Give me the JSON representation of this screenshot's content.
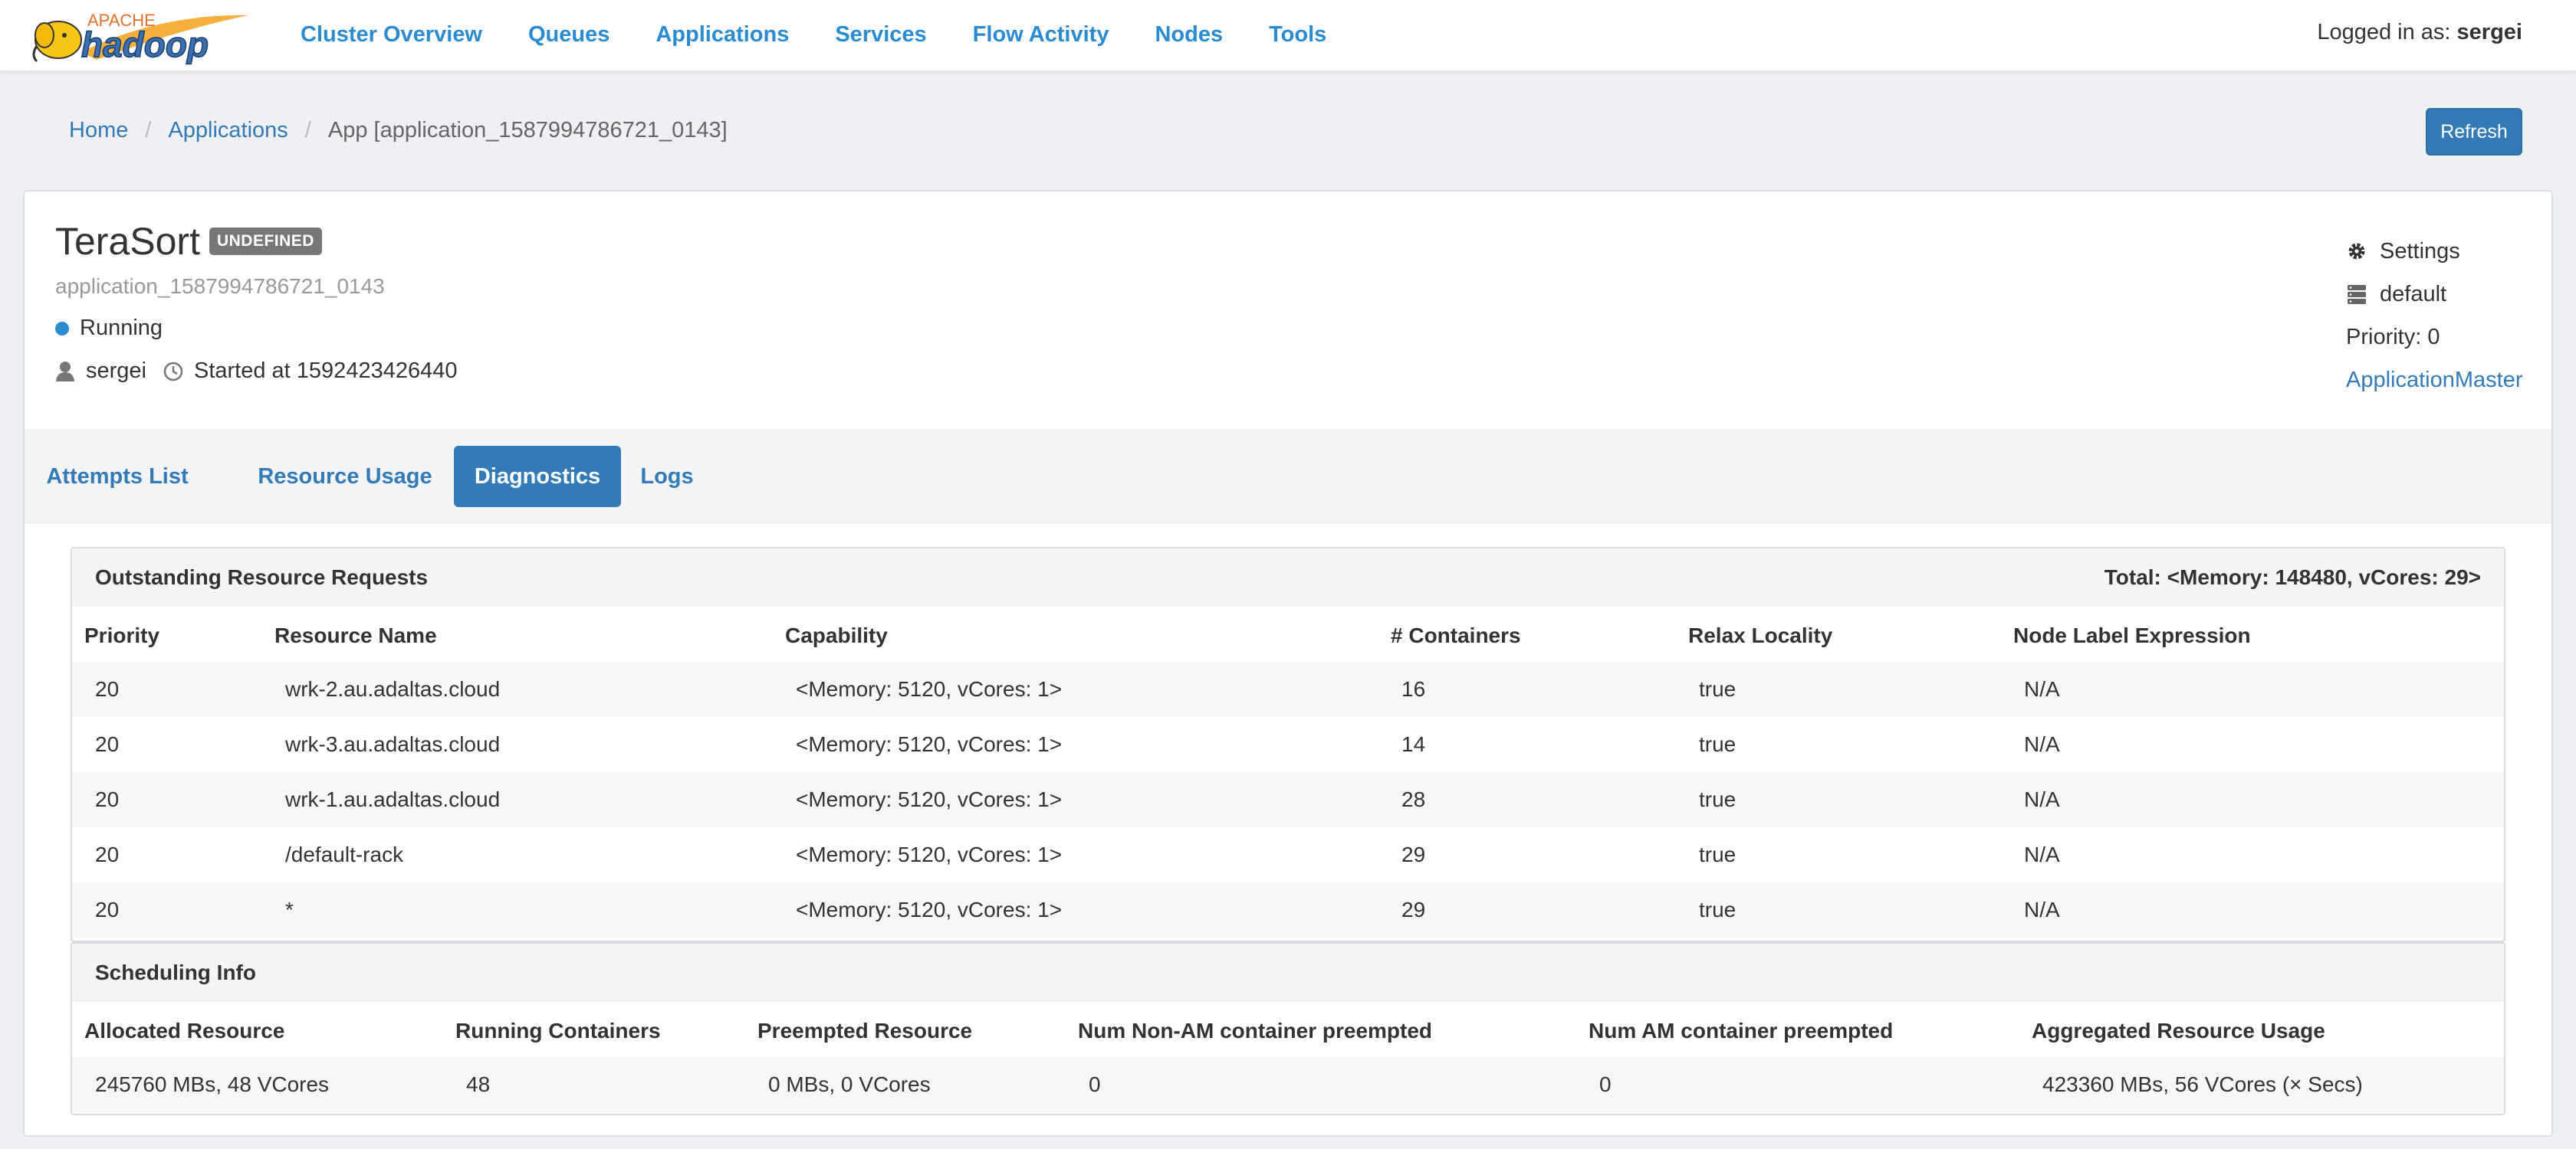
{
  "nav": {
    "logo_top": "APACHE",
    "logo_main": "hadoop",
    "links": [
      "Cluster Overview",
      "Queues",
      "Applications",
      "Services",
      "Flow Activity",
      "Nodes",
      "Tools"
    ],
    "login_prefix": "Logged in as:",
    "login_user": "sergei"
  },
  "breadcrumb": {
    "items": [
      "Home",
      "Applications"
    ],
    "current": "App [application_1587994786721_0143]"
  },
  "refresh_label": "Refresh",
  "app": {
    "name": "TeraSort",
    "badge": "UNDEFINED",
    "id": "application_1587994786721_0143",
    "state": "Running",
    "user": "sergei",
    "started": "Started at 1592423426440"
  },
  "side": {
    "settings": "Settings",
    "queue": "default",
    "priority": "Priority: 0",
    "am_link": "ApplicationMaster"
  },
  "tabs": [
    "Attempts List",
    "Resource Usage",
    "Diagnostics",
    "Logs"
  ],
  "active_tab": "Diagnostics",
  "requests": {
    "title": "Outstanding Resource Requests",
    "total": "Total: <Memory: 148480, vCores: 29>",
    "columns": [
      "Priority",
      "Resource Name",
      "Capability",
      "# Containers",
      "Relax Locality",
      "Node Label Expression"
    ],
    "rows": [
      [
        "20",
        "wrk-2.au.adaltas.cloud",
        "<Memory: 5120, vCores: 1>",
        "16",
        "true",
        "N/A"
      ],
      [
        "20",
        "wrk-3.au.adaltas.cloud",
        "<Memory: 5120, vCores: 1>",
        "14",
        "true",
        "N/A"
      ],
      [
        "20",
        "wrk-1.au.adaltas.cloud",
        "<Memory: 5120, vCores: 1>",
        "28",
        "true",
        "N/A"
      ],
      [
        "20",
        "/default-rack",
        "<Memory: 5120, vCores: 1>",
        "29",
        "true",
        "N/A"
      ],
      [
        "20",
        "*",
        "<Memory: 5120, vCores: 1>",
        "29",
        "true",
        "N/A"
      ]
    ]
  },
  "scheduling": {
    "title": "Scheduling Info",
    "columns": [
      "Allocated Resource",
      "Running Containers",
      "Preempted Resource",
      "Num Non-AM container preempted",
      "Num AM container preempted",
      "Aggregated Resource Usage"
    ],
    "rows": [
      [
        "245760 MBs, 48 VCores",
        "48",
        "0 MBs, 0 VCores",
        "0",
        "0",
        "423360 MBs, 56 VCores (× Secs)"
      ]
    ]
  },
  "colors": {
    "brand_blue": "#337ab7",
    "nav_blue": "#2a8bd1",
    "badge_gray": "#777777",
    "state_running": "#2a8bd1",
    "logo_yellow": "#f5c518"
  }
}
